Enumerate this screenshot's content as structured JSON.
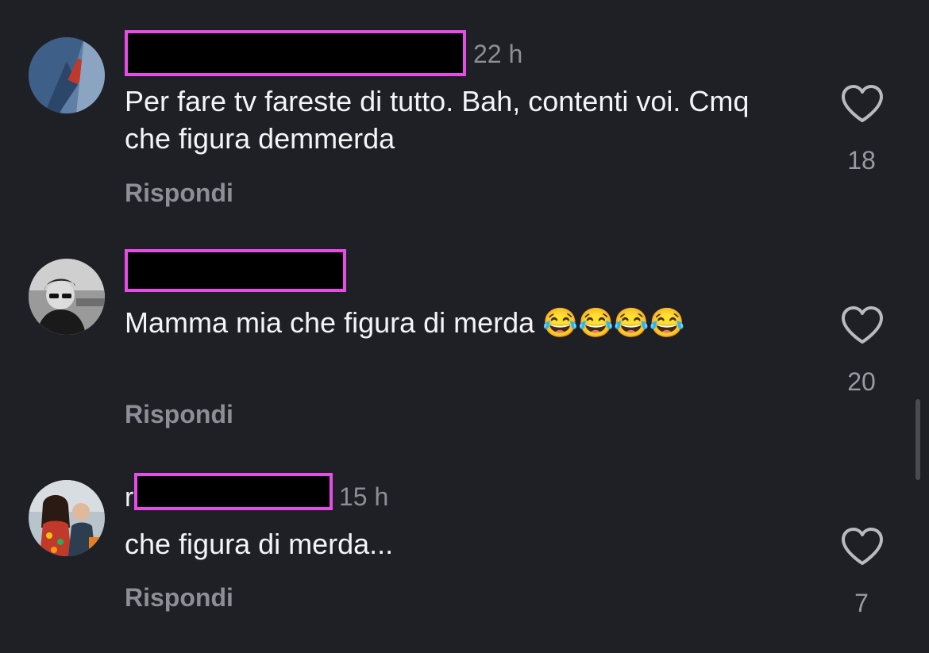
{
  "comments": [
    {
      "username_prefix": "",
      "timestamp": "22 h",
      "text": "Per fare tv fareste di tutto. Bah, contenti voi. Cmq che figura demmerda",
      "reply_label": "Rispondi",
      "likes": "18"
    },
    {
      "username_prefix": "",
      "timestamp": "",
      "text": "Mamma mia che figura di merda 😂😂😂😂",
      "reply_label": "Rispondi",
      "likes": "20"
    },
    {
      "username_prefix": "r",
      "timestamp": "15 h",
      "text": "che figura di merda...",
      "reply_label": "Rispondi",
      "likes": "7"
    }
  ],
  "colors": {
    "background": "#1f1f26",
    "redaction_border": "#e64ce6",
    "muted_text": "#8e8e96"
  },
  "icons": [
    "heart-outline-icon"
  ]
}
